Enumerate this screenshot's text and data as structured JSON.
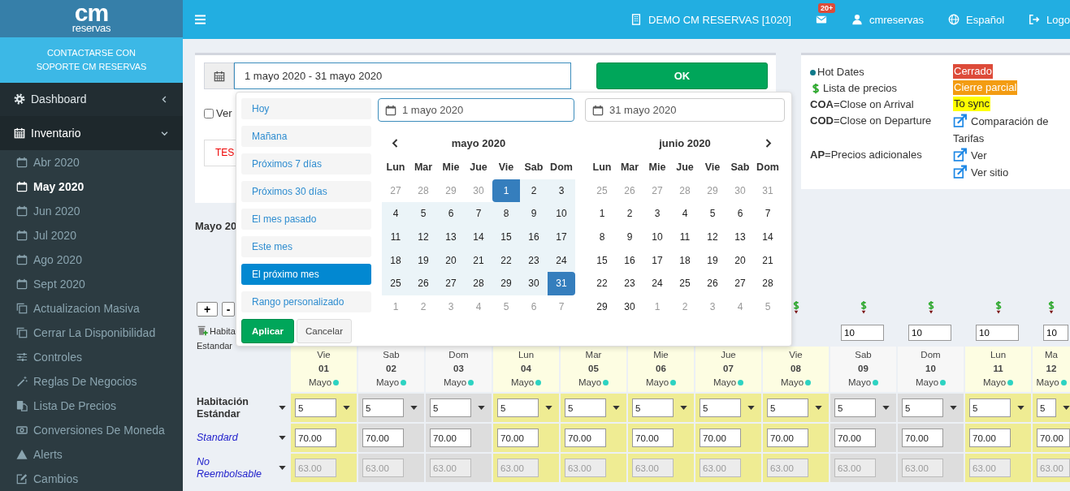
{
  "sidebar": {
    "logo": {
      "big": "cm",
      "small": "reservas"
    },
    "support": "CONTACTARSE CON SOPORTE CM RESERVAS",
    "menu": [
      {
        "label": "Dashboard",
        "kind": "gear",
        "expanded": false
      },
      {
        "label": "Inventario",
        "kind": "calendar-grid",
        "expanded": true,
        "children": [
          {
            "label": "Abr 2020",
            "kind": "calendar",
            "selected": false
          },
          {
            "label": "May 2020",
            "kind": "calendar",
            "selected": true
          },
          {
            "label": "Jun 2020",
            "kind": "calendar",
            "selected": false
          },
          {
            "label": "Jul 2020",
            "kind": "calendar",
            "selected": false
          },
          {
            "label": "Ago 2020",
            "kind": "calendar",
            "selected": false
          },
          {
            "label": "Sept 2020",
            "kind": "calendar",
            "selected": false
          },
          {
            "label": "Actualizacion Masiva",
            "kind": "copy",
            "selected": false
          },
          {
            "label": "Cerrar La Disponibilidad",
            "kind": "copy",
            "selected": false
          },
          {
            "label": "Controles",
            "kind": "sliders",
            "selected": false
          },
          {
            "label": "Reglas De Negocios",
            "kind": "wand",
            "selected": false
          },
          {
            "label": "Lista De Precios",
            "kind": "clipboard",
            "selected": false
          },
          {
            "label": "Conversiones De Moneda",
            "kind": "money",
            "selected": false
          },
          {
            "label": "Alerts",
            "kind": "warning",
            "selected": false
          },
          {
            "label": "Cambios",
            "kind": "edit",
            "selected": false
          }
        ]
      }
    ]
  },
  "topbar": {
    "items": [
      {
        "kind": "building",
        "label": "DEMO CM RESERVAS [1020]"
      },
      {
        "kind": "envelope",
        "badge": "20+"
      },
      {
        "kind": "user",
        "label": "cmreservas"
      },
      {
        "kind": "globe",
        "label": "Español"
      },
      {
        "kind": "signout",
        "label": "Logo"
      }
    ]
  },
  "filter": {
    "date_range": "1 mayo 2020 - 31 mayo 2020",
    "ok": "OK",
    "checkbox": {
      "label": "Ver",
      "checked": false
    },
    "note": "TES"
  },
  "datepicker": {
    "ranges": [
      {
        "label": "Hoy",
        "selected": false
      },
      {
        "label": "Mañana",
        "selected": false
      },
      {
        "label": "Próximos 7 días",
        "selected": false
      },
      {
        "label": "Próximos 30 días",
        "selected": false
      },
      {
        "label": "El mes pasado",
        "selected": false
      },
      {
        "label": "Este mes",
        "selected": false
      },
      {
        "label": "El próximo mes",
        "selected": true
      },
      {
        "label": "Rango personalizado",
        "selected": false
      }
    ],
    "apply": "Aplicar",
    "cancel": "Cancelar",
    "start": "1 mayo 2020",
    "end": "31 mayo 2020",
    "calendars": [
      {
        "title": "mayo 2020",
        "weekdays": [
          "Lun",
          "Mar",
          "Mie",
          "Jue",
          "Vie",
          "Sab",
          "Dom"
        ],
        "weeks": [
          [
            {
              "d": "27",
              "kind": "off"
            },
            {
              "d": "28",
              "kind": "off"
            },
            {
              "d": "29",
              "kind": "off"
            },
            {
              "d": "30",
              "kind": "off"
            },
            {
              "d": "1",
              "kind": "start"
            },
            {
              "d": "2",
              "kind": "range"
            },
            {
              "d": "3",
              "kind": "range"
            }
          ],
          [
            {
              "d": "4",
              "kind": "range"
            },
            {
              "d": "5",
              "kind": "range"
            },
            {
              "d": "6",
              "kind": "range"
            },
            {
              "d": "7",
              "kind": "range"
            },
            {
              "d": "8",
              "kind": "range"
            },
            {
              "d": "9",
              "kind": "range"
            },
            {
              "d": "10",
              "kind": "range"
            }
          ],
          [
            {
              "d": "11",
              "kind": "range"
            },
            {
              "d": "12",
              "kind": "range"
            },
            {
              "d": "13",
              "kind": "range"
            },
            {
              "d": "14",
              "kind": "range"
            },
            {
              "d": "15",
              "kind": "range"
            },
            {
              "d": "16",
              "kind": "range"
            },
            {
              "d": "17",
              "kind": "range"
            }
          ],
          [
            {
              "d": "18",
              "kind": "range"
            },
            {
              "d": "19",
              "kind": "range"
            },
            {
              "d": "20",
              "kind": "range"
            },
            {
              "d": "21",
              "kind": "range"
            },
            {
              "d": "22",
              "kind": "range"
            },
            {
              "d": "23",
              "kind": "range"
            },
            {
              "d": "24",
              "kind": "range"
            }
          ],
          [
            {
              "d": "25",
              "kind": "range"
            },
            {
              "d": "26",
              "kind": "range"
            },
            {
              "d": "27",
              "kind": "range"
            },
            {
              "d": "28",
              "kind": "range"
            },
            {
              "d": "29",
              "kind": "range"
            },
            {
              "d": "30",
              "kind": "range"
            },
            {
              "d": "31",
              "kind": "end"
            }
          ],
          [
            {
              "d": "1",
              "kind": "off"
            },
            {
              "d": "2",
              "kind": "off"
            },
            {
              "d": "3",
              "kind": "off"
            },
            {
              "d": "4",
              "kind": "off"
            },
            {
              "d": "5",
              "kind": "off"
            },
            {
              "d": "6",
              "kind": "off"
            },
            {
              "d": "7",
              "kind": "off"
            }
          ]
        ]
      },
      {
        "title": "junio 2020",
        "weekdays": [
          "Lun",
          "Mar",
          "Mie",
          "Jue",
          "Vie",
          "Sab",
          "Dom"
        ],
        "weeks": [
          [
            {
              "d": "25",
              "kind": "off"
            },
            {
              "d": "26",
              "kind": "off"
            },
            {
              "d": "27",
              "kind": "off"
            },
            {
              "d": "28",
              "kind": "off"
            },
            {
              "d": "29",
              "kind": "off"
            },
            {
              "d": "30",
              "kind": "off"
            },
            {
              "d": "31",
              "kind": "off"
            }
          ],
          [
            {
              "d": "1",
              "kind": "day"
            },
            {
              "d": "2",
              "kind": "day"
            },
            {
              "d": "3",
              "kind": "day"
            },
            {
              "d": "4",
              "kind": "day"
            },
            {
              "d": "5",
              "kind": "day"
            },
            {
              "d": "6",
              "kind": "day"
            },
            {
              "d": "7",
              "kind": "day"
            }
          ],
          [
            {
              "d": "8",
              "kind": "day"
            },
            {
              "d": "9",
              "kind": "day"
            },
            {
              "d": "10",
              "kind": "day"
            },
            {
              "d": "11",
              "kind": "day"
            },
            {
              "d": "12",
              "kind": "day"
            },
            {
              "d": "13",
              "kind": "day"
            },
            {
              "d": "14",
              "kind": "day"
            }
          ],
          [
            {
              "d": "15",
              "kind": "day"
            },
            {
              "d": "16",
              "kind": "day"
            },
            {
              "d": "17",
              "kind": "day"
            },
            {
              "d": "18",
              "kind": "day"
            },
            {
              "d": "19",
              "kind": "day"
            },
            {
              "d": "20",
              "kind": "day"
            },
            {
              "d": "21",
              "kind": "day"
            }
          ],
          [
            {
              "d": "22",
              "kind": "day"
            },
            {
              "d": "23",
              "kind": "day"
            },
            {
              "d": "24",
              "kind": "day"
            },
            {
              "d": "25",
              "kind": "day"
            },
            {
              "d": "26",
              "kind": "day"
            },
            {
              "d": "27",
              "kind": "day"
            },
            {
              "d": "28",
              "kind": "day"
            }
          ],
          [
            {
              "d": "29",
              "kind": "day"
            },
            {
              "d": "30",
              "kind": "day"
            },
            {
              "d": "1",
              "kind": "off"
            },
            {
              "d": "2",
              "kind": "off"
            },
            {
              "d": "3",
              "kind": "off"
            },
            {
              "d": "4",
              "kind": "off"
            },
            {
              "d": "5",
              "kind": "off"
            }
          ]
        ]
      }
    ]
  },
  "legend": {
    "rows": [
      {
        "left": {
          "kind": "dot",
          "text": "Hot Dates"
        },
        "right": {
          "kind": "badge",
          "text": "Cerrado",
          "color": "#dd4b39"
        }
      },
      {
        "left": {
          "kind": "dollar",
          "text": "Lista de precios"
        },
        "right": {
          "kind": "badge",
          "text": "Cierre parcial",
          "color": "#f39c12"
        }
      },
      {
        "left": {
          "kind": "text",
          "text": "**COA**=Close on Arrival"
        },
        "right": {
          "kind": "badge",
          "text": "To sync",
          "color": "#ffff00"
        }
      },
      {
        "left": {
          "kind": "text",
          "text": "**COD**=Close on Departure"
        },
        "right": {
          "kind": "link",
          "text": "Comparación de Tarifas"
        }
      },
      {
        "left": {
          "kind": "text",
          "text": "**AP**=Precios adicionales"
        },
        "right": {
          "kind": "link",
          "text": "Ver"
        }
      },
      {
        "right": {
          "kind": "link",
          "text": "Ver sitio"
        }
      }
    ]
  },
  "title": "Mayo 20",
  "grid": {
    "add": "+",
    "remove": "-",
    "caption_lines": [
      "Habita",
      "Estandar"
    ],
    "days": [
      {
        "dow": "Vie",
        "day": "01",
        "month": "Mayo",
        "weekend": false,
        "hot": true
      },
      {
        "dow": "Sab",
        "day": "02",
        "month": "Mayo",
        "weekend": true,
        "hot": true
      },
      {
        "dow": "Dom",
        "day": "03",
        "month": "Mayo",
        "weekend": true,
        "hot": true
      },
      {
        "dow": "Lun",
        "day": "04",
        "month": "Mayo",
        "weekend": false,
        "hot": true
      },
      {
        "dow": "Mar",
        "day": "05",
        "month": "Mayo",
        "weekend": false,
        "hot": true
      },
      {
        "dow": "Mie",
        "day": "06",
        "month": "Mayo",
        "weekend": false,
        "hot": true
      },
      {
        "dow": "Jue",
        "day": "07",
        "month": "Mayo",
        "weekend": false,
        "hot": true
      },
      {
        "dow": "Vie",
        "day": "08",
        "month": "Mayo",
        "weekend": false,
        "hot": true,
        "price_list": true
      },
      {
        "dow": "Sab",
        "day": "09",
        "month": "Mayo",
        "weekend": true,
        "hot": true,
        "price_list": true,
        "count": "10"
      },
      {
        "dow": "Dom",
        "day": "10",
        "month": "Mayo",
        "weekend": true,
        "hot": true,
        "price_list": true,
        "count": "10"
      },
      {
        "dow": "Lun",
        "day": "11",
        "month": "Mayo",
        "weekend": false,
        "hot": true,
        "price_list": true,
        "count": "10"
      },
      {
        "dow": "Ma",
        "day": "12",
        "month": "Mayo",
        "weekend": false,
        "hot": true,
        "price_list": true,
        "count": "10"
      }
    ],
    "rows": [
      {
        "label": "Habitación Estándar",
        "kind": "room",
        "disabled": false,
        "cells": [
          "5",
          "5",
          "5",
          "5",
          "5",
          "5",
          "5",
          "5",
          "5",
          "5",
          "5",
          "5"
        ]
      },
      {
        "label": "Standard",
        "kind": "rate",
        "disabled": false,
        "cells": [
          "70.00",
          "70.00",
          "70.00",
          "70.00",
          "70.00",
          "70.00",
          "70.00",
          "70.00",
          "70.00",
          "70.00",
          "70.00",
          "70.00"
        ]
      },
      {
        "label": "No Reembolsable",
        "kind": "rate",
        "disabled": true,
        "cells": [
          "63.00",
          "63.00",
          "63.00",
          "63.00",
          "63.00",
          "63.00",
          "63.00",
          "63.00",
          "63.00",
          "63.00",
          "63.00",
          "63.00"
        ]
      }
    ]
  }
}
